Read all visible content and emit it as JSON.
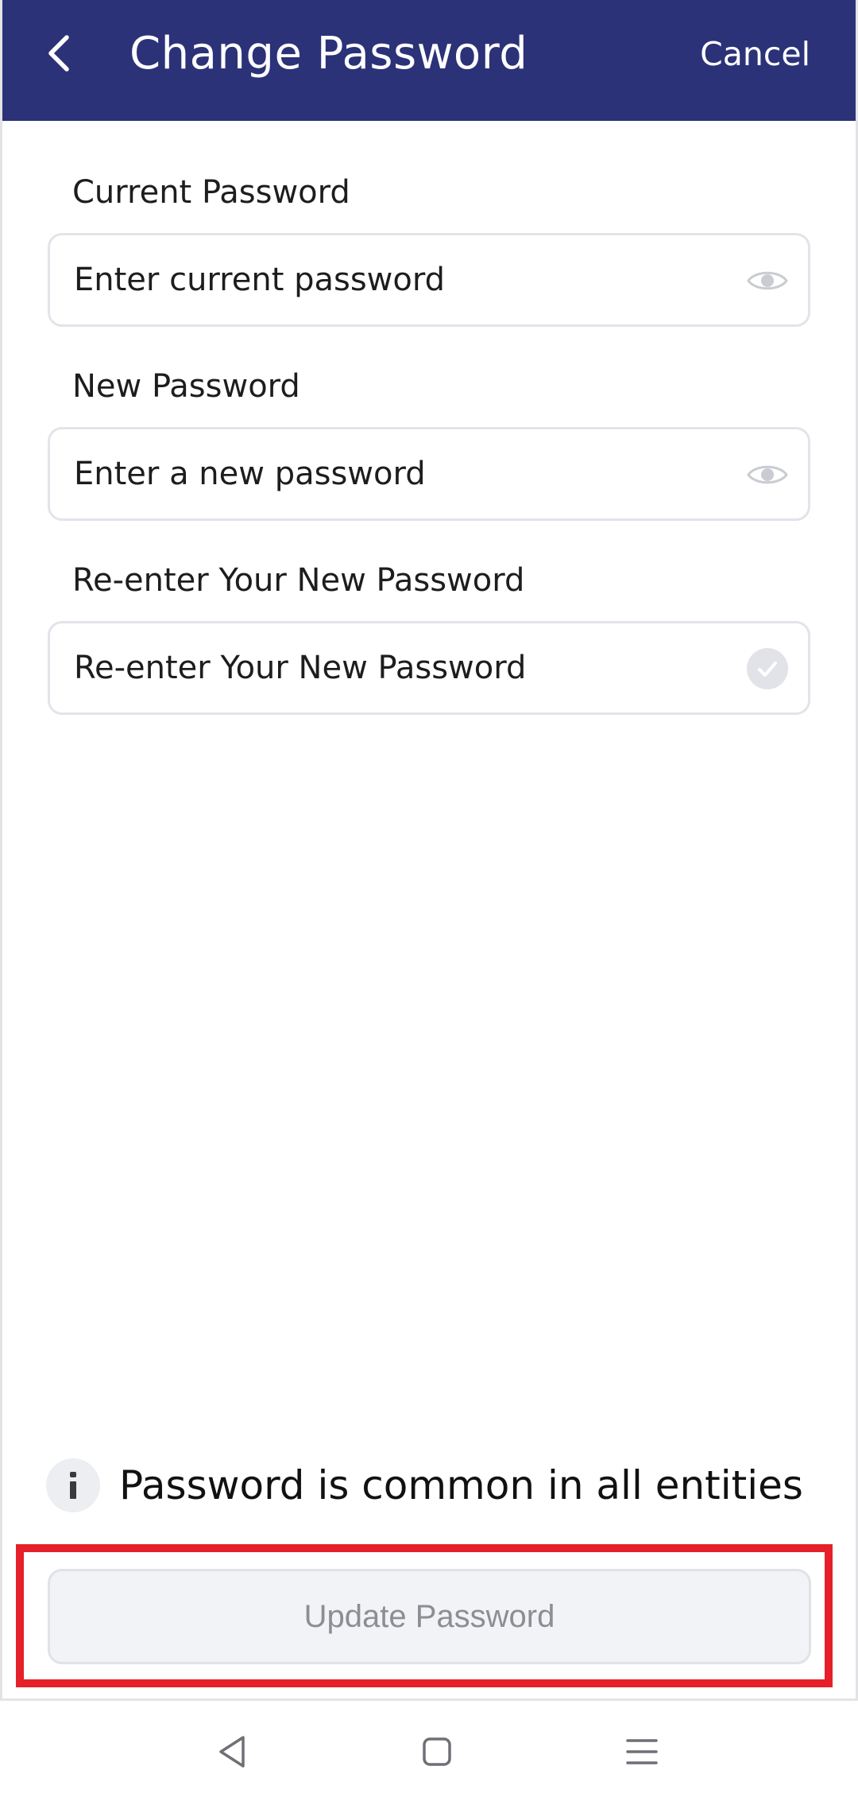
{
  "header": {
    "title": "Change Password",
    "cancel_label": "Cancel",
    "background_color": "#2b3278",
    "back_icon": "chevron-left-icon"
  },
  "form": {
    "fields": [
      {
        "label": "Current Password",
        "placeholder": "Enter current password",
        "value": "",
        "icon": "eye-icon"
      },
      {
        "label": "New Password",
        "placeholder": "Enter a new password",
        "value": "",
        "icon": "eye-icon"
      },
      {
        "label": "Re-enter Your New Password",
        "placeholder": "Re-enter Your New Password",
        "value": "",
        "icon": "check-circle-icon"
      }
    ]
  },
  "info": {
    "icon": "info-icon",
    "text": "Password is common in all entities"
  },
  "actions": {
    "update_label": "Update Password",
    "update_state": "disabled",
    "highlight_color": "#e5202a"
  },
  "system_nav": {
    "back_icon": "triangle-back-icon",
    "home_icon": "square-home-icon",
    "recents_icon": "menu-lines-icon"
  }
}
